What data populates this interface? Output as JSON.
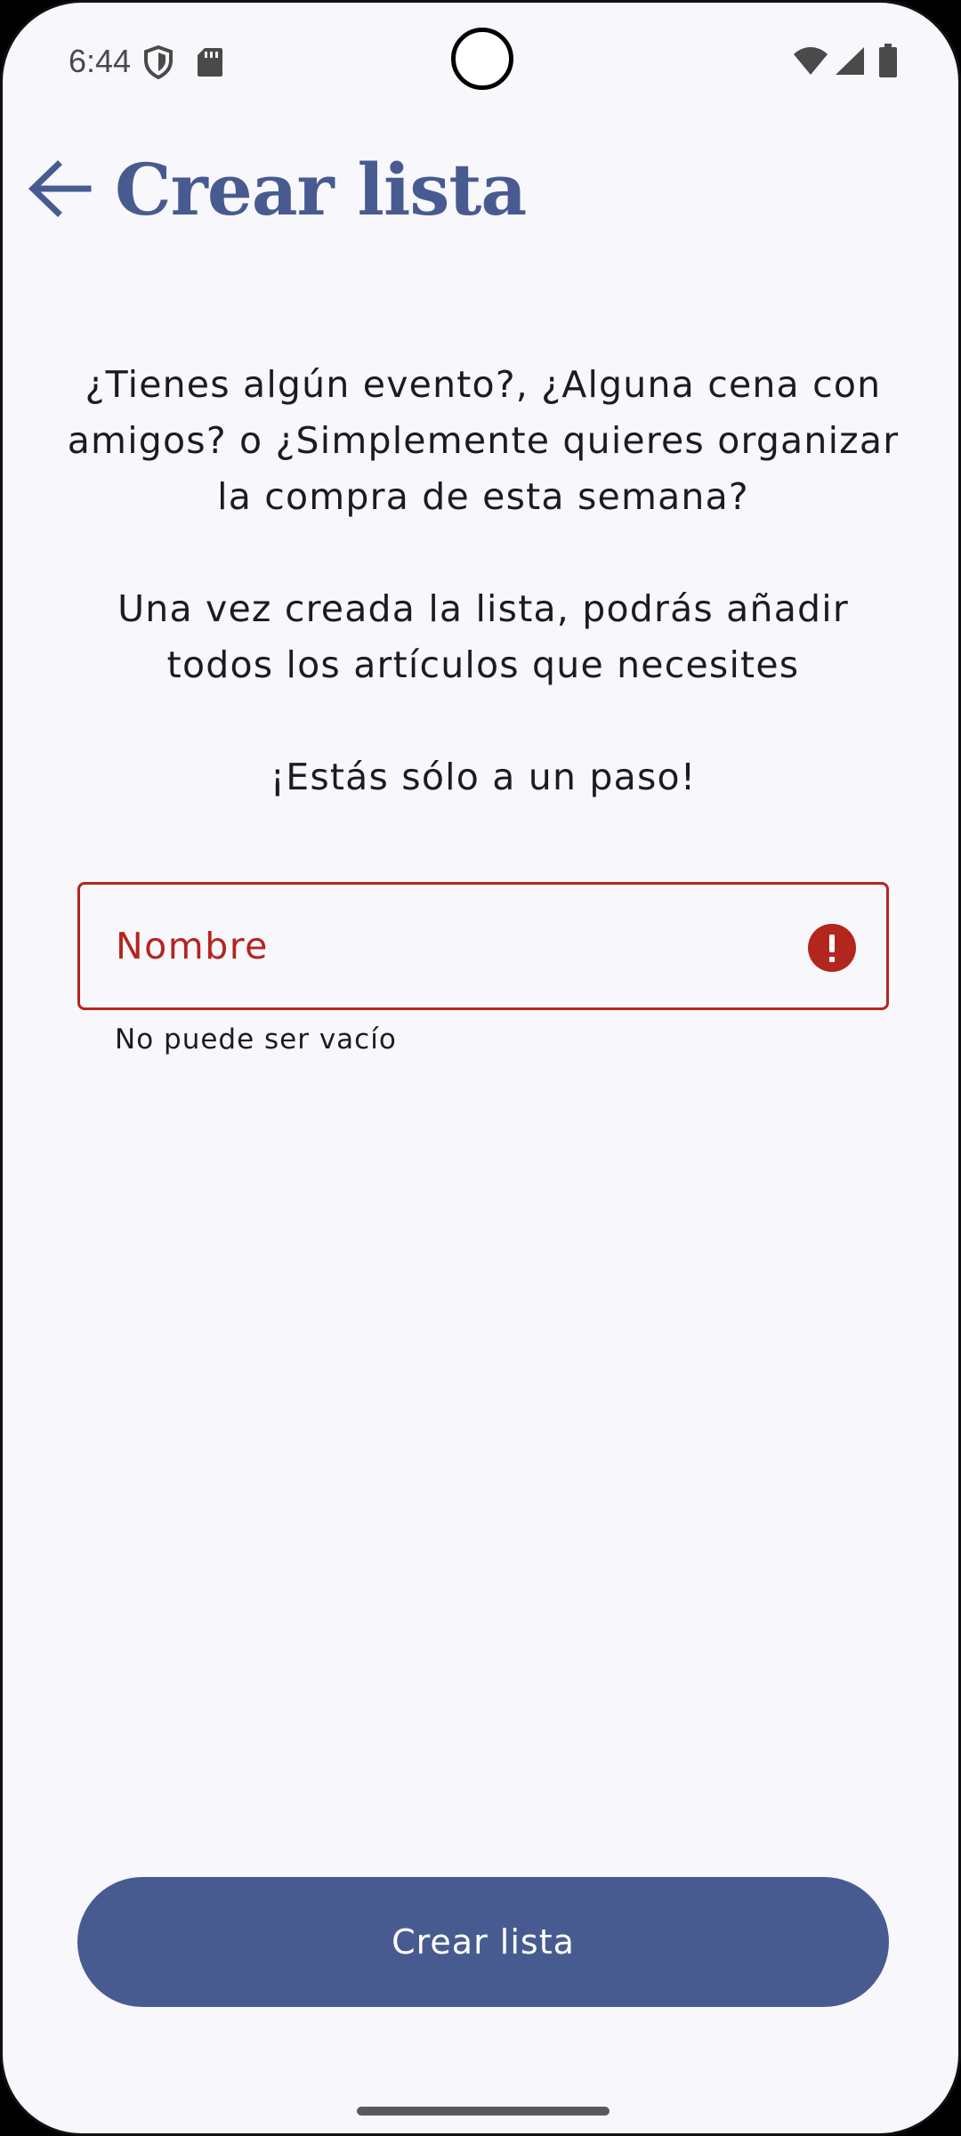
{
  "status_bar": {
    "time": "6:44",
    "icons": [
      "shield-icon",
      "sd-card-icon",
      "wifi-icon",
      "signal-icon",
      "battery-icon"
    ]
  },
  "header": {
    "title": "Crear lista",
    "back_icon": "arrow-back-icon"
  },
  "intro": {
    "paragraph_1": "¿Tienes algún evento?, ¿Alguna cena con amigos? o ¿Simplemente quieres organizar la compra de esta semana?",
    "paragraph_2": "Una vez creada la lista, podrás añadir todos los artículos que necesites",
    "paragraph_3": "¡Estás sólo a un paso!"
  },
  "form": {
    "name_field": {
      "value": "",
      "placeholder": "Nombre",
      "error_icon": "error-icon",
      "helper_text": "No puede ser vacío"
    },
    "submit_label": "Crear lista"
  },
  "colors": {
    "primary": "#485b91",
    "error": "#b3261e",
    "background": "#f8f7fc",
    "on_surface": "#1d1b20"
  }
}
